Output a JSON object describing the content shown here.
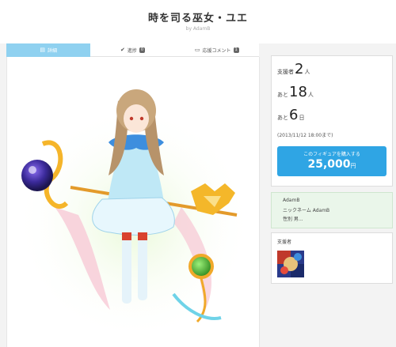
{
  "page": {
    "title": "時を司る巫女・ユエ",
    "byline": "by AdamB"
  },
  "tabs": [
    {
      "label": "詳細",
      "icon": "document-icon",
      "active": true
    },
    {
      "label": "進捗",
      "icon": "check-circle-icon",
      "count": "0"
    },
    {
      "label": "応援コメント",
      "icon": "comment-icon",
      "count": "1"
    }
  ],
  "stats": {
    "supporters_prefix": "支援者",
    "supporters_count": "2",
    "supporters_unit": "人",
    "remaining_prefix": "あと",
    "remaining_count": "18",
    "remaining_unit": "人",
    "days_prefix": "あと",
    "days_count": "6",
    "days_unit": "日",
    "deadline": "(2013/11/12 18:00まで)"
  },
  "buy": {
    "label": "このフィギュアを購入する",
    "price": "25,000",
    "currency": "円"
  },
  "profile": {
    "name": "AdamB",
    "nickname": "ニックネーム  AdamB",
    "gender": "性別  男..."
  },
  "supporters_box": {
    "label": "支援者"
  },
  "colors": {
    "tab_active": "#8fd1f0",
    "button": "#2fa5e4",
    "profile_bg": "#eaf6ea"
  }
}
